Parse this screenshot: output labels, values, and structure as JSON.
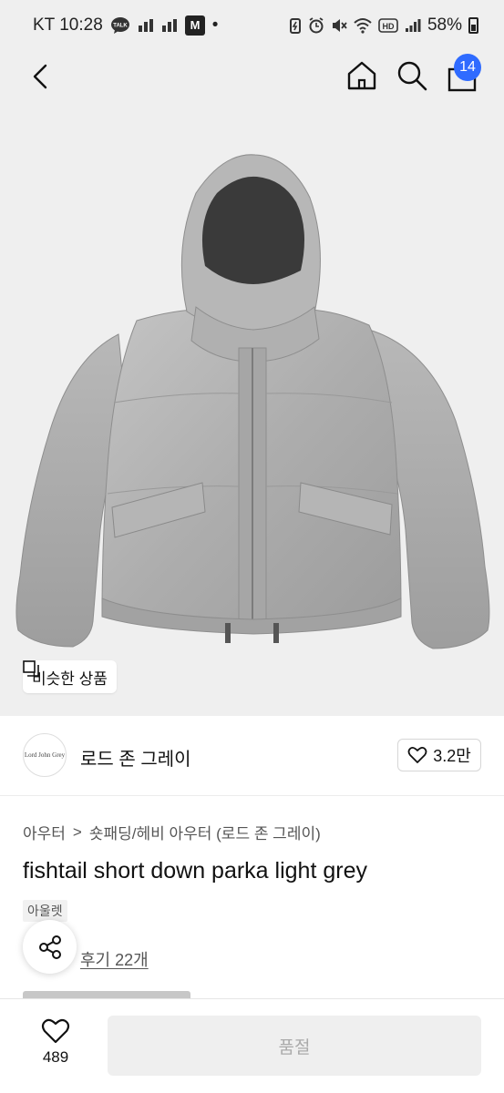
{
  "status_bar": {
    "carrier_time": "KT 10:28",
    "talk_label": "TALK",
    "m_stock_label": "M",
    "dot": "•",
    "hd_label": "HD",
    "battery_text": "58%"
  },
  "header": {
    "cart_count": "14"
  },
  "hero": {
    "similar_button_label": "비슷한 상품"
  },
  "brand": {
    "logo_text": "Lord John Grey",
    "name": "로드 존 그레이",
    "like_count": "3.2만"
  },
  "breadcrumb": {
    "level1": "아우터",
    "separator": ">",
    "level2": "숏패딩/헤비 아우터 (로드 존 그레이)"
  },
  "product": {
    "title": "fishtail short down parka light grey",
    "badge": "아울렛",
    "review_link": "후기 22개"
  },
  "bottom_bar": {
    "wish_count": "489",
    "action_label": "품절"
  },
  "colors": {
    "accent_badge": "#2f6bff",
    "hero_background": "#efefef",
    "jacket_grey": "#a9a9a9",
    "disabled_text": "#aaaaaa"
  }
}
